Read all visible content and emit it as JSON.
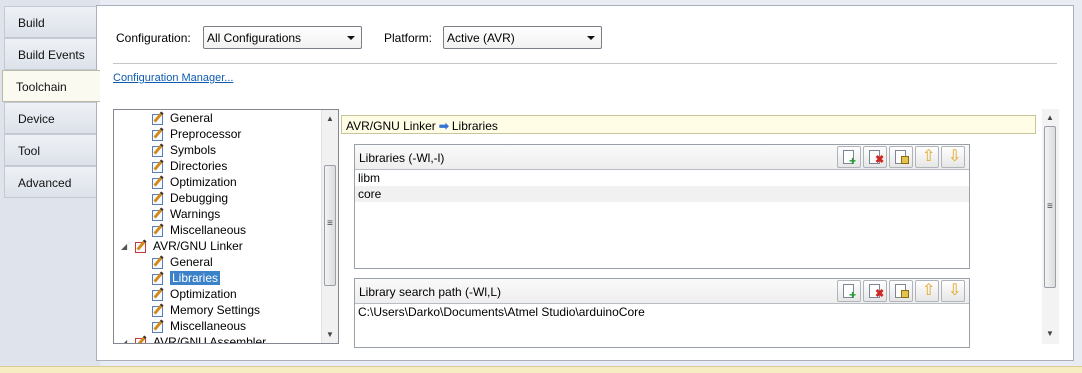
{
  "tabs": [
    {
      "label": "Build"
    },
    {
      "label": "Build Events"
    },
    {
      "label": "Toolchain"
    },
    {
      "label": "Device"
    },
    {
      "label": "Tool"
    },
    {
      "label": "Advanced"
    }
  ],
  "active_tab": "Toolchain",
  "header": {
    "configuration_label": "Configuration:",
    "configuration_value": "All Configurations",
    "platform_label": "Platform:",
    "platform_value": "Active (AVR)",
    "config_manager_link": "Configuration Manager..."
  },
  "tree": {
    "items": [
      {
        "label": "General",
        "level": 2
      },
      {
        "label": "Preprocessor",
        "level": 2
      },
      {
        "label": "Symbols",
        "level": 2
      },
      {
        "label": "Directories",
        "level": 2
      },
      {
        "label": "Optimization",
        "level": 2
      },
      {
        "label": "Debugging",
        "level": 2
      },
      {
        "label": "Warnings",
        "level": 2
      },
      {
        "label": "Miscellaneous",
        "level": 2
      },
      {
        "label": "AVR/GNU Linker",
        "level": 1,
        "expanded": true
      },
      {
        "label": "General",
        "level": 2
      },
      {
        "label": "Libraries",
        "level": 2,
        "selected": true
      },
      {
        "label": "Optimization",
        "level": 2
      },
      {
        "label": "Memory Settings",
        "level": 2
      },
      {
        "label": "Miscellaneous",
        "level": 2
      },
      {
        "label": "AVR/GNU Assembler",
        "level": 1,
        "expanded": true
      }
    ]
  },
  "breadcrumb": {
    "parent": "AVR/GNU Linker",
    "arrow_icon": "right-arrow-icon",
    "child": "Libraries"
  },
  "libraries_group": {
    "title": "Libraries (-Wl,-l)",
    "rows": [
      "libm",
      "core"
    ]
  },
  "search_path_group": {
    "title": "Library search path (-Wl,L)",
    "rows": [
      "C:\\Users\\Darko\\Documents\\Atmel Studio\\arduinoCore"
    ]
  },
  "toolbar_icons": [
    "add-item-icon",
    "delete-item-icon",
    "edit-item-icon",
    "move-up-icon",
    "move-down-icon"
  ],
  "colors": {
    "selection": "#3b82c8",
    "link": "#0f5bb0",
    "breadcrumb_bg": "#fffde6"
  }
}
